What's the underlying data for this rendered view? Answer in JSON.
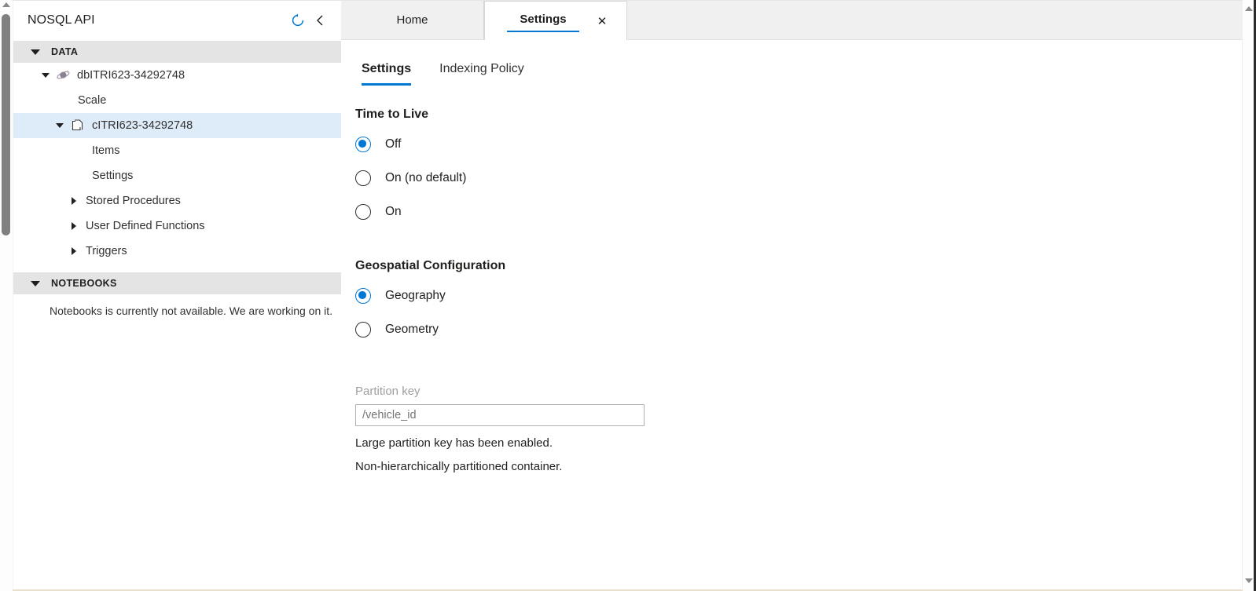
{
  "sidebar": {
    "title": "NOSQL API",
    "refresh_icon": "refresh-icon",
    "collapse_icon": "chevron-left-icon",
    "sections": [
      {
        "label": "DATA",
        "items": [
          {
            "label": "dbITRI623-34292748",
            "icon": "database-icon",
            "caret": "down",
            "level": "db",
            "selected": false
          },
          {
            "label": "Scale",
            "icon": "",
            "caret": "none",
            "level": "leaf1",
            "selected": false
          },
          {
            "label": "cITRI623-34292748",
            "icon": "container-icon",
            "caret": "down",
            "level": "coll",
            "selected": true
          },
          {
            "label": "Items",
            "icon": "",
            "caret": "none",
            "level": "leaf2",
            "selected": false
          },
          {
            "label": "Settings",
            "icon": "",
            "caret": "none",
            "level": "leaf2",
            "selected": false
          },
          {
            "label": "Stored Procedures",
            "icon": "",
            "caret": "right",
            "level": "exp2",
            "selected": false
          },
          {
            "label": "User Defined Functions",
            "icon": "",
            "caret": "right",
            "level": "exp2",
            "selected": false
          },
          {
            "label": "Triggers",
            "icon": "",
            "caret": "right",
            "level": "exp2",
            "selected": false
          }
        ]
      },
      {
        "label": "NOTEBOOKS",
        "message": "Notebooks is currently not available. We are working on it.",
        "items": []
      }
    ]
  },
  "tabs": [
    {
      "label": "Home",
      "active": false,
      "closable": false
    },
    {
      "label": "Settings",
      "active": true,
      "closable": true,
      "close_icon": "close-icon"
    }
  ],
  "subtabs": [
    {
      "label": "Settings",
      "active": true
    },
    {
      "label": "Indexing Policy",
      "active": false
    }
  ],
  "settings": {
    "ttl": {
      "title": "Time to Live",
      "options": [
        {
          "label": "Off",
          "checked": true
        },
        {
          "label": "On (no default)",
          "checked": false
        },
        {
          "label": "On",
          "checked": false
        }
      ]
    },
    "geospatial": {
      "title": "Geospatial Configuration",
      "options": [
        {
          "label": "Geography",
          "checked": true
        },
        {
          "label": "Geometry",
          "checked": false
        }
      ]
    },
    "partition_key": {
      "label": "Partition key",
      "value": "/vehicle_id",
      "placeholder": "/vehicle_id",
      "notes": [
        "Large partition key has been enabled.",
        "Non-hierarchically partitioned container."
      ]
    }
  },
  "colors": {
    "accent": "#0078d4",
    "selection": "#deecf9",
    "section_header": "#e4e4e4",
    "tabbar": "#f0f0f0",
    "disabled_text": "#a19f9d"
  }
}
